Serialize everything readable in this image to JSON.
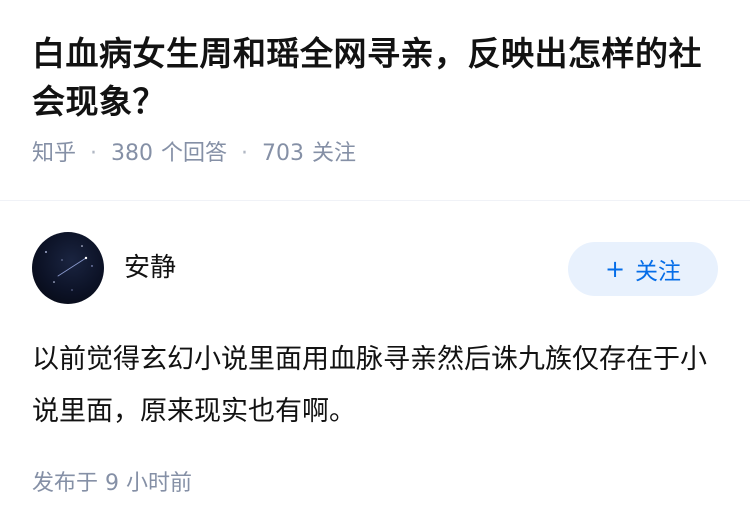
{
  "question": {
    "title": "白血病女生周和瑶全网寻亲，反映出怎样的社会现象？",
    "source": "知乎",
    "separator": "·",
    "answers_count": "380",
    "answers_label": "个回答",
    "followers_count": "703",
    "followers_label": "关注"
  },
  "answer": {
    "author_name": "安静",
    "avatar_icon": "avatar-starry-night",
    "follow_button": {
      "icon": "plus-icon",
      "icon_glyph": "+",
      "label": "关注",
      "color": "#056de8",
      "background": "#e8f1fd"
    },
    "content": "以前觉得玄幻小说里面用血脉寻亲然后诛九族仅存在于小说里面，原来现实也有啊。",
    "time": "发布于 9 小时前"
  }
}
